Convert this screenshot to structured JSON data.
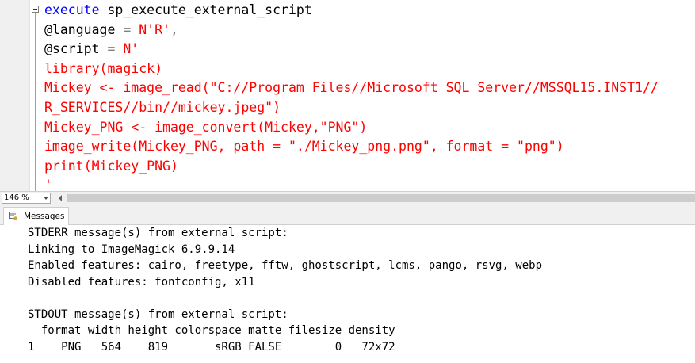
{
  "editor": {
    "lines": [
      {
        "parts": [
          {
            "c": "kw",
            "t": "execute"
          },
          {
            "c": "var",
            "t": " "
          },
          {
            "c": "var",
            "t": "sp_execute_external_script"
          }
        ]
      },
      {
        "parts": [
          {
            "c": "var",
            "t": "@language"
          },
          {
            "c": "op",
            "t": " = "
          },
          {
            "c": "str",
            "t": "N'R'"
          },
          {
            "c": "op",
            "t": ","
          }
        ]
      },
      {
        "parts": [
          {
            "c": "var",
            "t": "@script"
          },
          {
            "c": "op",
            "t": " = "
          },
          {
            "c": "str",
            "t": "N'"
          }
        ]
      },
      {
        "parts": [
          {
            "c": "str",
            "t": "library(magick)"
          }
        ]
      },
      {
        "parts": [
          {
            "c": "str",
            "t": "Mickey <- image_read(\"C://Program Files//Microsoft SQL Server//MSSQL15.INST1//"
          }
        ]
      },
      {
        "parts": [
          {
            "c": "str",
            "t": "R_SERVICES//bin//mickey.jpeg\")"
          }
        ]
      },
      {
        "parts": [
          {
            "c": "str",
            "t": "Mickey_PNG <- image_convert(Mickey,\"PNG\")"
          }
        ]
      },
      {
        "parts": [
          {
            "c": "str",
            "t": "image_write(Mickey_PNG, path = \"./Mickey_png.png\", format = \"png\")"
          }
        ]
      },
      {
        "parts": [
          {
            "c": "str",
            "t": "print(Mickey_PNG)"
          }
        ]
      },
      {
        "parts": [
          {
            "c": "str",
            "t": "'"
          }
        ]
      }
    ]
  },
  "zoom": {
    "value": "146 %"
  },
  "results": {
    "tab_label": "Messages",
    "tab_icon": "messages-icon",
    "lines": [
      "STDERR message(s) from external script:",
      "Linking to ImageMagick 6.9.9.14",
      "Enabled features: cairo, freetype, fftw, ghostscript, lcms, pango, rsvg, webp",
      "Disabled features: fontconfig, x11",
      "",
      "STDOUT message(s) from external script:",
      "  format width height colorspace matte filesize density",
      "1    PNG   564    819       sRGB FALSE        0   72x72"
    ]
  }
}
